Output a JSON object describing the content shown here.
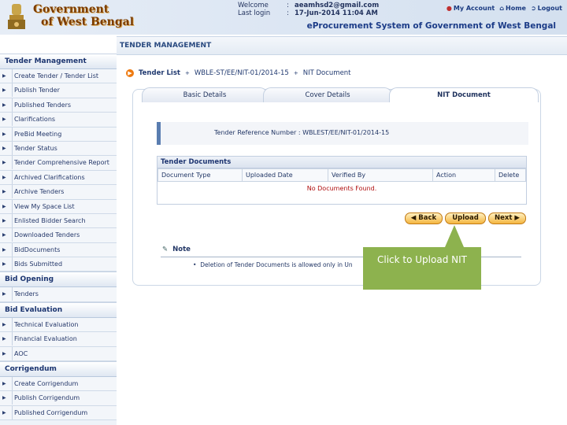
{
  "header": {
    "logo_line1": "Government",
    "logo_line2": "of West Bengal",
    "welcome_label": "Welcome",
    "welcome_value": "aeamhsd2@gmail.com",
    "lastlogin_label": "Last login",
    "lastlogin_value": "17-Jun-2014 11:04 AM",
    "colon": ":",
    "link_account": "My Account",
    "link_home": "Home",
    "link_logout": "Logout",
    "system_title": "eProcurement System of Government of West Bengal"
  },
  "page_title": "TENDER MANAGEMENT",
  "sidebar": {
    "sections": [
      {
        "title": "Tender Management",
        "items": [
          "Create Tender / Tender List",
          "Publish Tender",
          "Published Tenders",
          "Clarifications",
          "PreBid Meeting",
          "Tender Status",
          "Tender Comprehensive Report",
          "Archived Clarifications",
          "Archive Tenders",
          "View My Space List",
          "Enlisted Bidder Search",
          "Downloaded Tenders",
          "BidDocuments",
          "Bids Submitted"
        ]
      },
      {
        "title": "Bid Opening",
        "items": [
          "Tenders"
        ]
      },
      {
        "title": "Bid Evaluation",
        "items": [
          "Technical Evaluation",
          "Financial Evaluation",
          "AOC"
        ]
      },
      {
        "title": "Corrigendum",
        "items": [
          "Create Corrigendum",
          "Publish Corrigendum",
          "Published Corrigendum"
        ]
      }
    ]
  },
  "breadcrumb": {
    "items": [
      "Tender List",
      "WBLE-ST/EE/NIT-01/2014-15",
      "NIT Document"
    ],
    "separator": "+"
  },
  "tabs": [
    "Basic Details",
    "Cover Details",
    "NIT Document"
  ],
  "reference": "Tender Reference Number :  WBLEST/EE/NIT-01/2014-15",
  "documents": {
    "title": "Tender Documents",
    "columns": [
      "Document Type",
      "Uploaded Date",
      "Verified By",
      "Action",
      "Delete"
    ],
    "empty_message": "No Documents Found."
  },
  "buttons": {
    "back": "Back",
    "upload": "Upload",
    "next": "Next"
  },
  "note": {
    "title": "Note",
    "item": "Deletion of Tender Documents is allowed only in Un"
  },
  "callout": {
    "text": "Click to Upload NIT",
    "color": "#8db24e"
  },
  "colors": {
    "header_bg": "#dfe8f4",
    "button_gradient": "#f4b640",
    "accent_orange": "#ee7a10"
  }
}
